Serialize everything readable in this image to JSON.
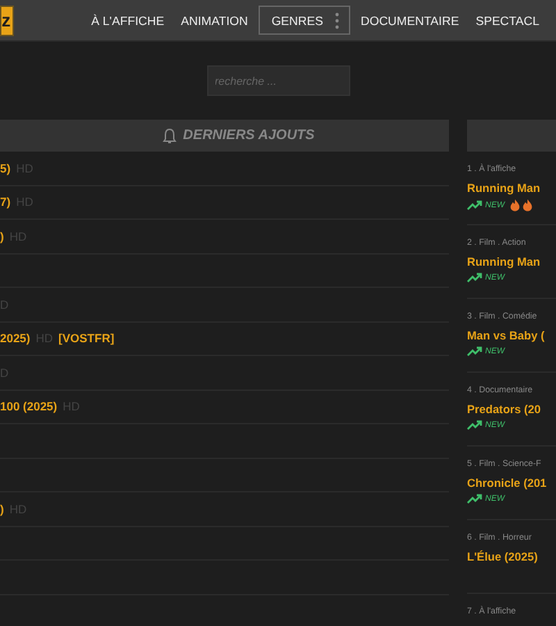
{
  "logo": "z",
  "nav": [
    {
      "label": "À L'AFFICHE",
      "kind": "link"
    },
    {
      "label": "ANIMATION",
      "kind": "link"
    },
    {
      "label": "GENRES",
      "kind": "dropdown"
    },
    {
      "label": "DOCUMENTAIRE",
      "kind": "link"
    },
    {
      "label": "SPECTACL",
      "kind": "link"
    }
  ],
  "search": {
    "placeholder": "recherche ..."
  },
  "latest": {
    "title": "DERNIERS AJOUTS",
    "rows": [
      {
        "title": "5)",
        "quality": "HD"
      },
      {
        "title": "7)",
        "quality": "HD"
      },
      {
        "title": ")",
        "quality": "HD"
      },
      {},
      {
        "quality": "D"
      },
      {
        "title": "2025)",
        "quality": "HD",
        "tag": "[VOSTFR]"
      },
      {
        "quality": "D"
      },
      {
        "title": "100 (2025)",
        "quality": "HD"
      },
      {},
      {},
      {
        "title": ")",
        "quality": "HD"
      },
      {},
      {},
      {}
    ]
  },
  "trending": [
    {
      "category": "1 . À l'affiche",
      "title": "Running Man",
      "new": "NEW",
      "hot": true
    },
    {
      "category": "2 . Film . Action",
      "title": "Running Man",
      "new": "NEW",
      "hot": false
    },
    {
      "category": "3 . Film . Comédie",
      "title": "Man vs Baby (",
      "new": "NEW",
      "hot": false
    },
    {
      "category": "4 . Documentaire",
      "title": "Predators (20",
      "new": "NEW",
      "hot": false
    },
    {
      "category": "5 . Film . Science-F",
      "title": "Chronicle (201",
      "new": "NEW",
      "hot": false
    },
    {
      "category": "6 . Film . Horreur",
      "title": "L'Élue (2025)",
      "hot": false
    },
    {
      "category": "7 . À l'affiche"
    }
  ]
}
